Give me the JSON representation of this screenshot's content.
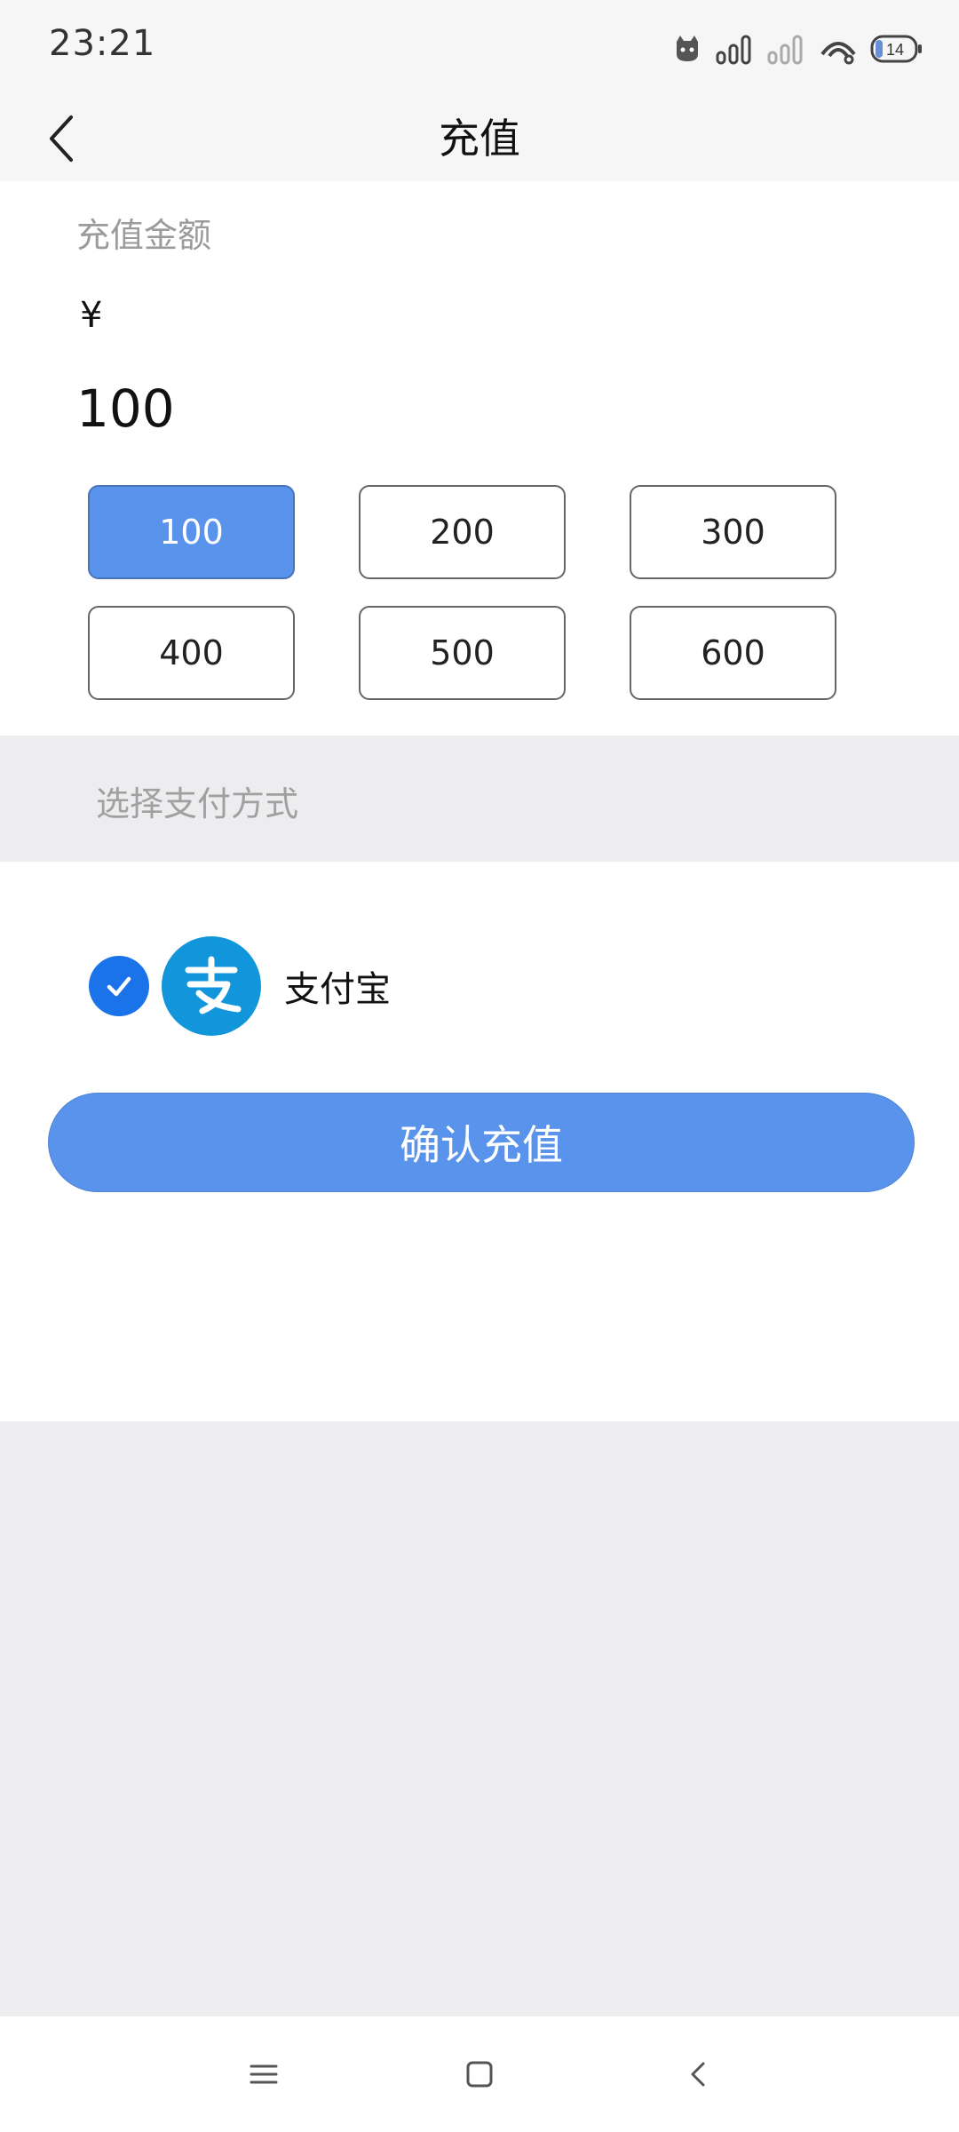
{
  "status_bar": {
    "time": "23:21",
    "battery": "14",
    "icons": [
      "cat-notification-icon",
      "signal-icon",
      "signal-weak-icon",
      "hotspot-icon",
      "battery-icon"
    ]
  },
  "header": {
    "title": "充值",
    "back_icon": "chevron-left-icon"
  },
  "amount": {
    "label": "充值金额",
    "currency_symbol": "¥",
    "value": "100",
    "options": [
      "100",
      "200",
      "300",
      "400",
      "500",
      "600"
    ],
    "selected": "100"
  },
  "payment": {
    "section_label": "选择支付方式",
    "methods": [
      {
        "name": "支付宝",
        "icon": "alipay-icon",
        "checked": true
      }
    ]
  },
  "confirm_label": "确认充值",
  "colors": {
    "accent": "#5a93eb",
    "check": "#1a73e8",
    "alipay": "#1296db",
    "page_bg": "#ededf0"
  },
  "nav_bar": {
    "icons": [
      "menu-icon",
      "home-square-icon",
      "back-icon"
    ]
  }
}
